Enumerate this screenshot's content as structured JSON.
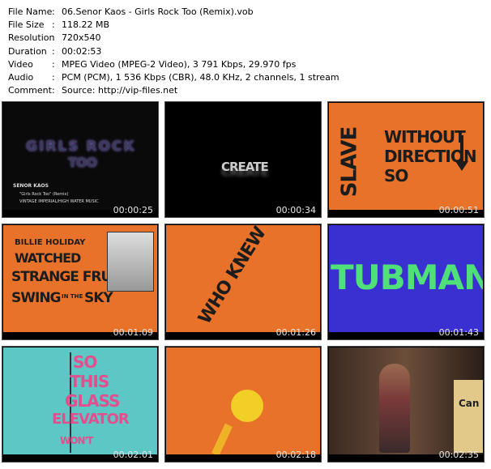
{
  "info": {
    "rows": [
      {
        "label": "File Name",
        "value": "06.Senor Kaos - Girls Rock Too (Remix).vob"
      },
      {
        "label": "File Size",
        "value": "118.22 MB"
      },
      {
        "label": "Resolution",
        "value": "720x540"
      },
      {
        "label": "Duration",
        "value": "00:02:53"
      },
      {
        "label": "Video",
        "value": "MPEG Video (MPEG-2 Video), 3 791 Kbps, 29.970 fps"
      },
      {
        "label": "Audio",
        "value": "PCM (PCM), 1 536 Kbps (CBR), 48.0 KHz, 2 channels, 1 stream"
      },
      {
        "label": "Comment",
        "value": "Source: http://vip-files.net"
      }
    ],
    "separator": ":"
  },
  "thumbnails": [
    {
      "time": "00:00:25",
      "texts": [
        "GIRLS ROCK",
        "TOO",
        "SENOR KAOS",
        "\"Girls Rock Too\" (Remix)",
        "VINTAGE IMPERIAL/HIGH WATER MUSIC"
      ]
    },
    {
      "time": "00:00:34",
      "texts": [
        "CREATE"
      ]
    },
    {
      "time": "00:00:51",
      "texts": [
        "SLAVE",
        "WITHOUT",
        "DIRECTION",
        "SO"
      ]
    },
    {
      "time": "00:01:09",
      "texts": [
        "BILLIE HOLIDAY",
        "WATCHED",
        "STRANGE FRUIT",
        "SWING",
        "IN THE",
        "SKY"
      ]
    },
    {
      "time": "00:01:26",
      "texts": [
        "WHO KNEW"
      ]
    },
    {
      "time": "00:01:43",
      "texts": [
        "TUBMAN"
      ]
    },
    {
      "time": "00:02:01",
      "texts": [
        "SO",
        "THIS",
        "GLASS",
        "ELEVATOR",
        "WON'T"
      ]
    },
    {
      "time": "00:02:18",
      "texts": []
    },
    {
      "time": "00:02:35",
      "texts": [
        "Can"
      ]
    }
  ],
  "colors": {
    "orange": "#e8722a",
    "dark": "#1c1c1c",
    "blue": "#3a2fd0",
    "green": "#4fe07a",
    "teal": "#5cc7c4",
    "pink": "#e24f8e",
    "yellow": "#f2cf27"
  }
}
